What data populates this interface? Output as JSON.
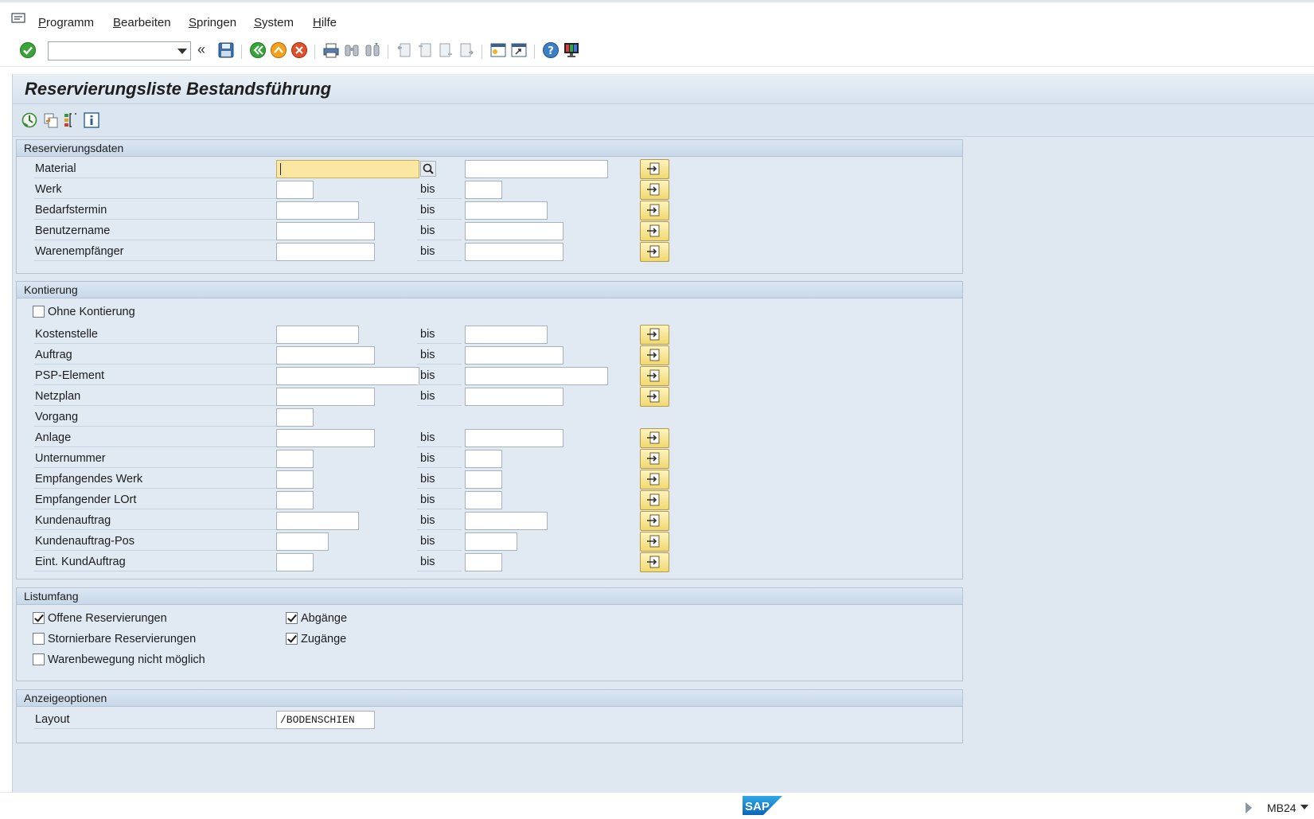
{
  "menu": {
    "items": [
      {
        "first": "P",
        "rest": "rogramm"
      },
      {
        "first": "B",
        "rest": "earbeiten"
      },
      {
        "first": "S",
        "rest": "pringen"
      },
      {
        "first": "S",
        "rest": "ystem"
      },
      {
        "first": "H",
        "rest": "ilfe"
      }
    ]
  },
  "toolbar": {
    "command_field_value": "",
    "collapse_glyph": "«"
  },
  "title": "Reservierungsliste Bestandsführung",
  "groups": {
    "reservierungsdaten": {
      "header": "Reservierungsdaten",
      "rows": [
        {
          "label": "Material",
          "bis": "",
          "from": "",
          "to": ""
        },
        {
          "label": "Werk",
          "bis": "bis",
          "from": "",
          "to": ""
        },
        {
          "label": "Bedarfstermin",
          "bis": "bis",
          "from": "",
          "to": ""
        },
        {
          "label": "Benutzername",
          "bis": "bis",
          "from": "",
          "to": ""
        },
        {
          "label": "Warenempfänger",
          "bis": "bis",
          "from": "",
          "to": ""
        }
      ]
    },
    "kontierung": {
      "header": "Kontierung",
      "checkbox_label": "Ohne Kontierung",
      "checkbox_checked": false,
      "rows": [
        {
          "label": "Kostenstelle",
          "bis": "bis"
        },
        {
          "label": "Auftrag",
          "bis": "bis"
        },
        {
          "label": "PSP-Element",
          "bis": "bis"
        },
        {
          "label": "Netzplan",
          "bis": "bis"
        },
        {
          "label": "Vorgang",
          "bis": ""
        },
        {
          "label": "Anlage",
          "bis": "bis"
        },
        {
          "label": "Unternummer",
          "bis": "bis"
        },
        {
          "label": "Empfangendes Werk",
          "bis": "bis"
        },
        {
          "label": "Empfangender LOrt",
          "bis": "bis"
        },
        {
          "label": "Kundenauftrag",
          "bis": "bis"
        },
        {
          "label": "Kundenauftrag-Pos",
          "bis": "bis"
        },
        {
          "label": "Eint. KundAuftrag",
          "bis": "bis"
        }
      ]
    },
    "listumfang": {
      "header": "Listumfang",
      "checkboxes": [
        {
          "label": "Offene Reservierungen",
          "checked": true
        },
        {
          "label": "Stornierbare Reservierungen",
          "checked": false
        },
        {
          "label": "Warenbewegung nicht möglich",
          "checked": false
        },
        {
          "label": "Abgänge",
          "checked": true
        },
        {
          "label": "Zugänge",
          "checked": true
        }
      ]
    },
    "anzeigeoptionen": {
      "header": "Anzeigeoptionen",
      "layout_label": "Layout",
      "layout_value": "/BODENSCHIEN"
    }
  },
  "status": {
    "logo_text": "SAP",
    "transaction": "MB24"
  },
  "colors": {
    "frame": "#dfe8f1",
    "focus_field": "#fbe6a2",
    "multi_select_button": "#f1d86e"
  }
}
